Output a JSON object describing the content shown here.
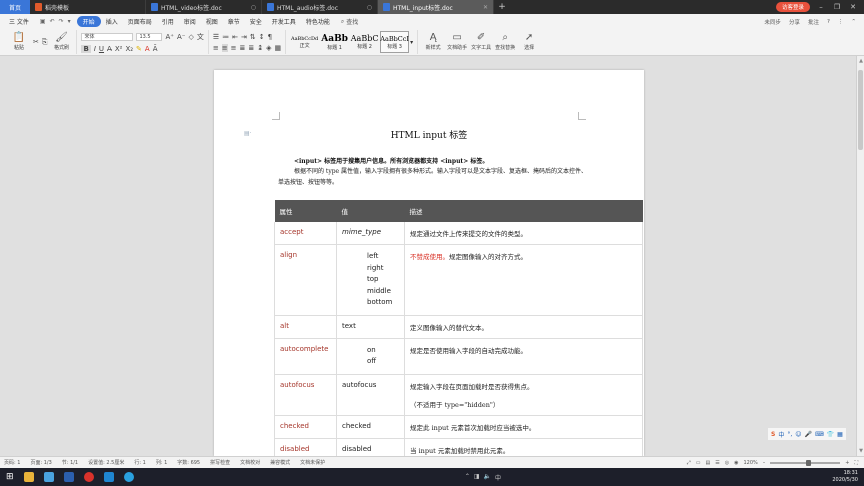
{
  "tabbar": {
    "home": "首页",
    "tabs": [
      {
        "label": "稻壳模板",
        "active": false
      },
      {
        "label": "HTML_video标签.doc",
        "active": false
      },
      {
        "label": "HTML_audio标签.doc",
        "active": false
      },
      {
        "label": "HTML_input标签.doc",
        "active": true
      }
    ],
    "add": "+",
    "login": "访客登录"
  },
  "menubar": {
    "file": "三 文件",
    "items": [
      "开始",
      "插入",
      "页面布局",
      "引用",
      "审阅",
      "视图",
      "章节",
      "安全",
      "开发工具",
      "特色功能"
    ],
    "active": "开始",
    "search": "查找",
    "right": [
      "未同步",
      "分享",
      "批注"
    ]
  },
  "ribbon": {
    "paste": "粘贴",
    "cut": "剪切",
    "copy": "复制",
    "format_painter": "格式刷",
    "font_name": "宋体",
    "font_size": "13.5",
    "styles": [
      {
        "sample": "AaBbCcDd",
        "label": "正文"
      },
      {
        "sample": "AaBb",
        "label": "标题 1"
      },
      {
        "sample": "AaBbC",
        "label": "标题 2"
      },
      {
        "sample": "AaBbCcI",
        "label": "标题 3"
      }
    ],
    "new_style": "新样式",
    "doc_helper": "文档助手",
    "text_tools": "文字工具",
    "find_replace": "查找替换",
    "select": "选择"
  },
  "document": {
    "title": "HTML input 标签",
    "intro_bold": "<input> 标签用于搜集用户信息。所有浏览器都支持 <input> 标签。",
    "intro_body": "根据不同的 type 属性值，输入字段拥有很多种形式。输入字段可以是文本字段、复选框、掩码后的文本控件、单选按钮、按钮等等。",
    "table": {
      "headers": [
        "属性",
        "值",
        "描述"
      ],
      "rows": [
        {
          "attr": "accept",
          "value": "mime_type",
          "desc": "规定通过文件上传来提交的文件的类型。"
        },
        {
          "attr": "align",
          "values": [
            "left",
            "right",
            "top",
            "middle",
            "bottom"
          ],
          "deprecated": "不赞成使用。",
          "desc": "规定图像输入的对齐方式。"
        },
        {
          "attr": "alt",
          "value": "text",
          "desc": "定义图像输入的替代文本。"
        },
        {
          "attr": "autocomplete",
          "values": [
            "on",
            "off"
          ],
          "desc": "规定是否使用输入字段的自动完成功能。"
        },
        {
          "attr": "autofocus",
          "value": "autofocus",
          "desc": "规定输入字段在页面加载时是否获得焦点。",
          "note": "（不适用于 type=\"hidden\"）"
        },
        {
          "attr": "checked",
          "value": "checked",
          "desc": "规定此 input 元素首次加载时应当被选中。"
        },
        {
          "attr": "disabled",
          "value": "disabled",
          "desc": "当 input 元素加载时禁用此元素。"
        }
      ]
    }
  },
  "statusbar": {
    "page": "页码: 1",
    "pages": "页面: 1/3",
    "section": "节: 1/1",
    "setting": "设置值: 2.5厘米",
    "row": "行: 1",
    "col": "列: 1",
    "words": "字数: 695",
    "spell": "拼写检查",
    "proof": "文档校对",
    "revise": "兼容模式",
    "protect": "文档未保护",
    "zoom": "120%",
    "zoom_fraction": 0.55
  },
  "taskbar": {
    "time": "18:31",
    "date": "2020/5/30"
  },
  "colors": {
    "accent": "#3a76d8",
    "attr_name": "#a5352a",
    "deprecated": "#d93025",
    "table_header": "#555555"
  }
}
